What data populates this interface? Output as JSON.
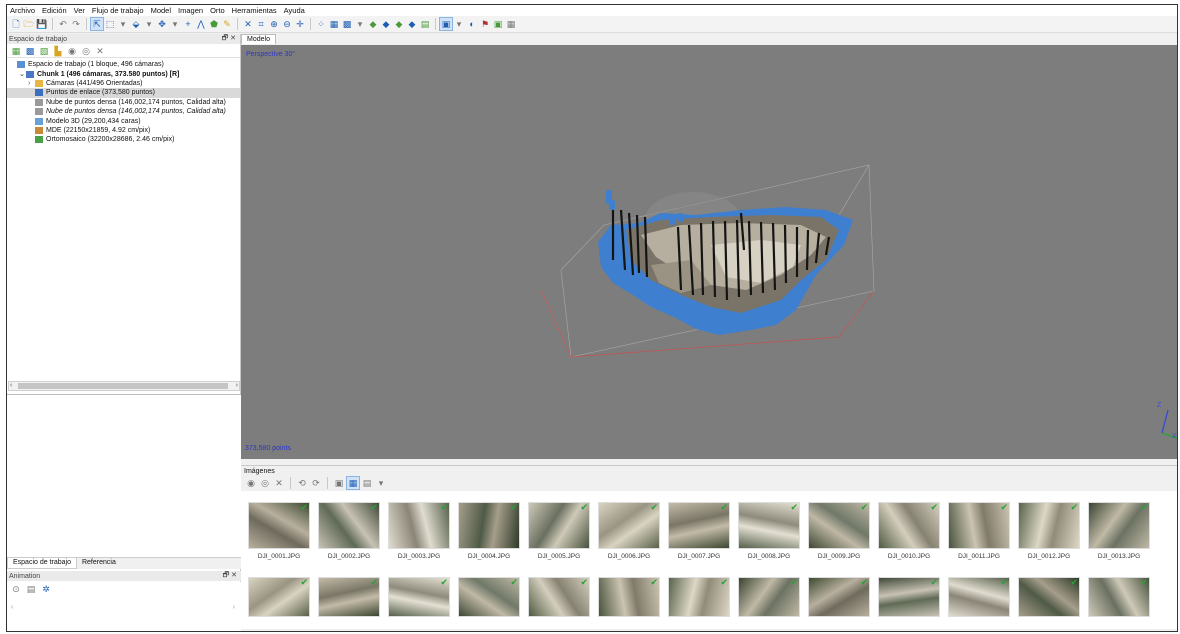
{
  "menu": [
    "Archivo",
    "Edición",
    "Ver",
    "Flujo de trabajo",
    "Model",
    "Imagen",
    "Orto",
    "Herramientas",
    "Ayuda"
  ],
  "workspace": {
    "title": "Espacio de trabajo",
    "close_glyph": "🗗 ✕",
    "tree": [
      {
        "label": "Espacio de trabajo (1 bloque, 496 cámaras)",
        "icon": "workspace-icon",
        "indent": 0,
        "style": ""
      },
      {
        "label": "Chunk 1 (496 cámaras, 373.580 puntos) [R]",
        "icon": "chunk-icon",
        "indent": 1,
        "style": "bold",
        "caret": "⌄"
      },
      {
        "label": "Cámaras (441/496 Orientadas)",
        "icon": "folder-icon",
        "indent": 2,
        "style": "",
        "caret": "›"
      },
      {
        "label": "Puntos de enlace (373,580 puntos)",
        "icon": "tie-points-icon",
        "indent": 2,
        "style": "sel"
      },
      {
        "label": "Nube de puntos densa (146,002,174 puntos, Calidad alta)",
        "icon": "dense-cloud-icon",
        "indent": 2,
        "style": ""
      },
      {
        "label": "Nube de puntos densa (146,002,174 puntos, Calidad alta)",
        "icon": "dense-cloud-icon",
        "indent": 2,
        "style": "it"
      },
      {
        "label": "Modelo 3D (29,200,434 caras)",
        "icon": "model-icon",
        "indent": 2,
        "style": ""
      },
      {
        "label": "MDE (22150x21859, 4.92 cm/pix)",
        "icon": "dem-icon",
        "indent": 2,
        "style": ""
      },
      {
        "label": "Ortomosaico (32200x28686, 2.46 cm/pix)",
        "icon": "ortho-icon",
        "indent": 2,
        "style": ""
      }
    ]
  },
  "bottom_tabs": [
    "Espacio de trabajo",
    "Referencia"
  ],
  "animation": {
    "title": "Animation",
    "close_glyph": "🗗 ✕"
  },
  "model_tab": "Modelo",
  "viewport": {
    "view_label": "Perspective 30°",
    "points_label": "373,580 points"
  },
  "images": {
    "title": "Imágenes",
    "row1": [
      "DJI_0001.JPG",
      "DJI_0002.JPG",
      "DJI_0003.JPG",
      "DJI_0004.JPG",
      "DJI_0005.JPG",
      "DJI_0006.JPG",
      "DJI_0007.JPG",
      "DJI_0008.JPG",
      "DJI_0009.JPG",
      "DJI_0010.JPG",
      "DJI_0011.JPG",
      "DJI_0012.JPG",
      "DJI_0013.JPG"
    ],
    "row2_count": 13
  },
  "colors": {
    "viewport_bg": "#7d7d7d",
    "label_blue": "#2a36c9",
    "ortho_blue": "#3f7fcf",
    "check_green": "#2aa03a"
  }
}
